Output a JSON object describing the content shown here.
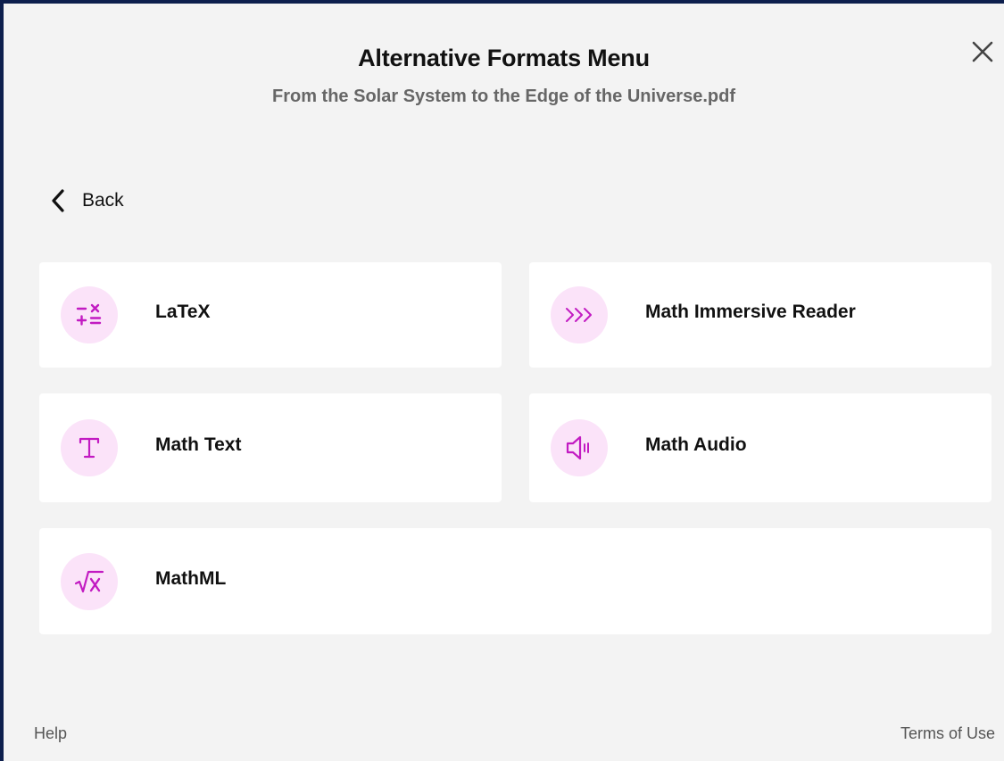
{
  "dialog": {
    "title": "Alternative Formats Menu",
    "subtitle": "From the Solar System to the Edge of the Universe.pdf",
    "close_icon": "close-icon"
  },
  "navigation": {
    "back_label": "Back",
    "back_icon": "chevron-left-icon"
  },
  "formats": [
    {
      "label": "LaTeX",
      "icon": "math-operators-icon"
    },
    {
      "label": "Math Immersive Reader",
      "icon": "triple-chevron-right-icon"
    },
    {
      "label": "Math Text",
      "icon": "text-t-icon"
    },
    {
      "label": "Math Audio",
      "icon": "speaker-icon"
    },
    {
      "label": "MathML",
      "icon": "square-root-icon"
    }
  ],
  "footer": {
    "help_label": "Help",
    "terms_label": "Terms of Use"
  },
  "colors": {
    "accent": "#c21bc2",
    "icon_background": "#fbe3f9",
    "frame_border": "#0d1f4d",
    "panel_background": "#f3f3f3",
    "card_background": "#ffffff"
  }
}
